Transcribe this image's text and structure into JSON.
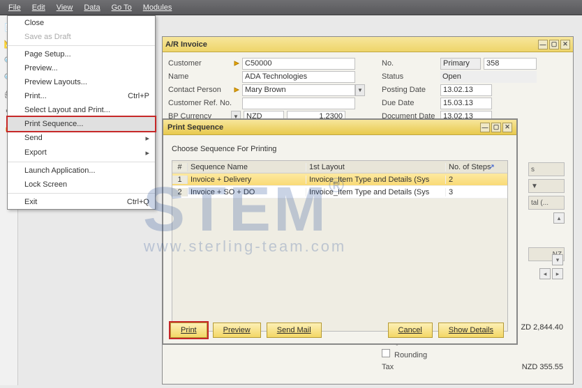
{
  "menubar": {
    "items": [
      "File",
      "Edit",
      "View",
      "Data",
      "Go To",
      "Modules"
    ]
  },
  "file_menu": {
    "items": [
      {
        "label": "Close",
        "kind": "item"
      },
      {
        "label": "Save as Draft",
        "kind": "disabled"
      },
      {
        "kind": "sep"
      },
      {
        "label": "Page Setup...",
        "kind": "item"
      },
      {
        "label": "Preview...",
        "kind": "item"
      },
      {
        "label": "Preview Layouts...",
        "kind": "item"
      },
      {
        "label": "Print...",
        "shortcut": "Ctrl+P",
        "kind": "item"
      },
      {
        "label": "Select Layout and Print...",
        "kind": "item"
      },
      {
        "label": "Print Sequence...",
        "kind": "highlighted"
      },
      {
        "label": "Send",
        "arrow": true,
        "kind": "item"
      },
      {
        "label": "Export",
        "arrow": true,
        "kind": "item"
      },
      {
        "kind": "sep"
      },
      {
        "label": "Launch Application...",
        "kind": "item"
      },
      {
        "label": "Lock Screen",
        "kind": "item"
      },
      {
        "kind": "sep"
      },
      {
        "label": "Exit",
        "shortcut": "Ctrl+Q",
        "kind": "item"
      }
    ]
  },
  "invoice": {
    "title": "A/R Invoice",
    "left": {
      "customer_lbl": "Customer",
      "customer": "C50000",
      "name_lbl": "Name",
      "name": "ADA Technologies",
      "contact_lbl": "Contact Person",
      "contact": "Mary Brown",
      "ref_lbl": "Customer Ref. No.",
      "ref": "",
      "currency_lbl": "BP Currency",
      "currency": "NZD",
      "rate": "1.2300"
    },
    "right": {
      "no_lbl": "No.",
      "no_mode": "Primary",
      "no": "358",
      "status_lbl": "Status",
      "status": "Open",
      "posting_lbl": "Posting Date",
      "posting": "13.02.13",
      "due_lbl": "Due Date",
      "due": "15.03.13",
      "doc_lbl": "Document Date",
      "doc": "13.02.13"
    }
  },
  "print_sequence": {
    "title": "Print Sequence",
    "subtitle": "Choose Sequence For Printing",
    "headers": {
      "num": "#",
      "name": "Sequence Name",
      "layout": "1st Layout",
      "steps": "No. of Steps"
    },
    "rows": [
      {
        "num": "1",
        "name": "Invoice + Delivery",
        "layout": "Invoice_Item Type and Details (Sys",
        "steps": "2",
        "selected": true
      },
      {
        "num": "2",
        "name": "Invoice + SO + DO",
        "layout": "Invoice_Item Type and Details (Sys",
        "steps": "3",
        "selected": false
      }
    ],
    "buttons": {
      "print": "Print",
      "preview": "Preview",
      "send": "Send Mail",
      "cancel": "Cancel",
      "details": "Show Details"
    }
  },
  "rhs": {
    "tab_s": "s",
    "dropdown": "▼",
    "tal": "tal (...",
    "nz": "NZ"
  },
  "totals": {
    "amount": "ZD 2,844.40",
    "freight_lbl": "Freight",
    "rounding_lbl": "Rounding",
    "tax_lbl": "Tax",
    "tax": "NZD 355.55"
  },
  "watermark": {
    "big": "STEM",
    "url": "www.sterling-team.com",
    "reg": "®"
  }
}
